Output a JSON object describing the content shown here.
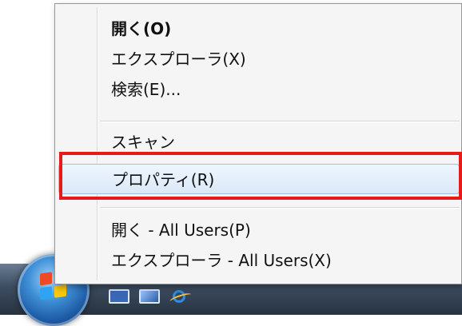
{
  "context_menu": {
    "items": [
      {
        "label": "開く(O)"
      },
      {
        "label": "エクスプローラ(X)"
      },
      {
        "label": "検索(E)..."
      },
      {
        "label": "スキャン"
      },
      {
        "label": "プロパティ(R)"
      },
      {
        "label": "開く - All Users(P)"
      },
      {
        "label": "エクスプローラ - All Users(X)"
      }
    ]
  },
  "taskbar": {
    "quick_launch": [
      {
        "icon": "show-desktop-icon"
      },
      {
        "icon": "switch-windows-icon"
      },
      {
        "icon": "internet-explorer-icon"
      }
    ]
  },
  "colors": {
    "highlight_border": "#e51b1b",
    "menu_background": "#f5f5f5",
    "hover_border": "#9fc1e6"
  }
}
